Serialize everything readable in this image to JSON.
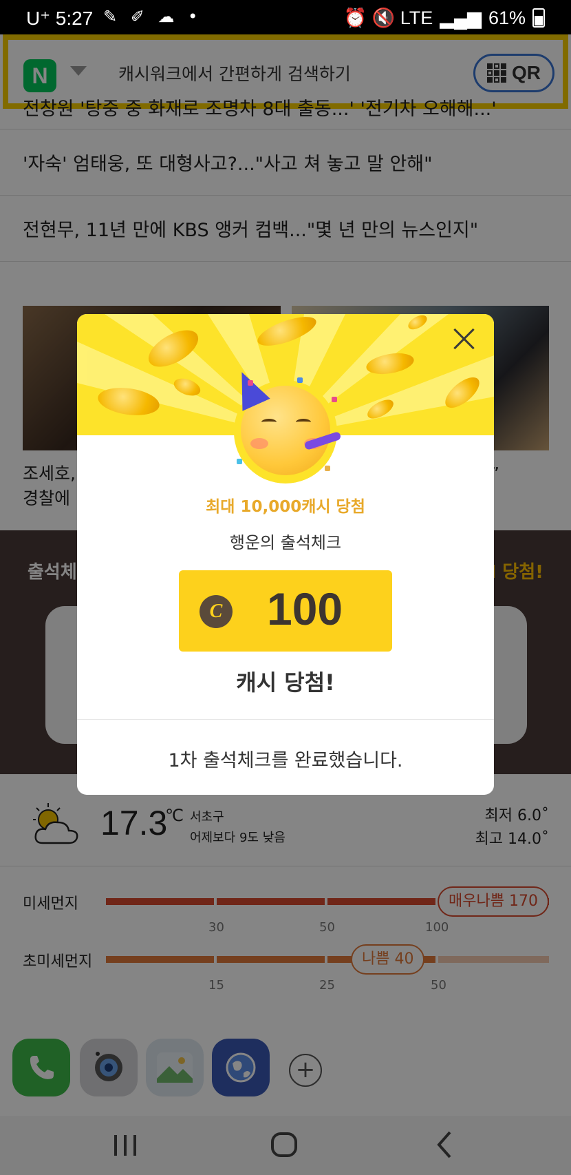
{
  "status_bar": {
    "carrier": "U⁺ 5:27",
    "notifications": "✎ ✐ ☁ •",
    "right_icons": "⏰ 🔇 LTE",
    "battery": "61%"
  },
  "search": {
    "brand_letter": "N",
    "placeholder": "캐시워크에서 간편하게 검색하기",
    "qr_label": "QR"
  },
  "news": {
    "items": [
      "전창원 '탕중 중 화재로 조명차 8대 출동...' '전기차 오해해...'",
      "'자숙' 엄태웅, 또 대형사고?...\"사고 쳐 놓고 말 안해\"",
      "전현무, 11년 만에 KBS 앵커 컴백...\"몇 년 만의 뉴스인지\""
    ],
    "captions": {
      "left_line1": "조세호,",
      "left_line2": "경찰에",
      "right_line1": "며”",
      "right_line2": "..."
    }
  },
  "attendance_section": {
    "title": "출석체",
    "right_label": "I 당첨!"
  },
  "weather": {
    "temperature": "17.3",
    "unit": "℃",
    "location": "서초구",
    "comparison": "어제보다 9도 낮음",
    "min": "최저 6.0˚",
    "max": "최고 14.0˚"
  },
  "dust": {
    "pm10_label": "미세먼지",
    "pm10_badge": "매우나쁨 170",
    "pm10_ticks": [
      "30",
      "50",
      "100"
    ],
    "pm25_label": "초미세먼지",
    "pm25_badge": "나쁨 40",
    "pm25_ticks": [
      "15",
      "25",
      "50"
    ]
  },
  "dock": {
    "apps": [
      "phone-app",
      "camera-app",
      "gallery-app",
      "internet-app"
    ],
    "add": "+"
  },
  "modal": {
    "subtitle": "최대 10,000캐시 당첨",
    "title": "행운의 출석체크",
    "coin_symbol": "C",
    "amount": "100",
    "win_text": "캐시 당첨!",
    "footer": "1차 출석체크를 완료했습니다."
  },
  "colors": {
    "banner": "#fde32a",
    "amount_box": "#fdd11c",
    "accent_text": "#e8a92a",
    "search_border": "#f7cd00",
    "dust_red": "#d64a2e"
  }
}
